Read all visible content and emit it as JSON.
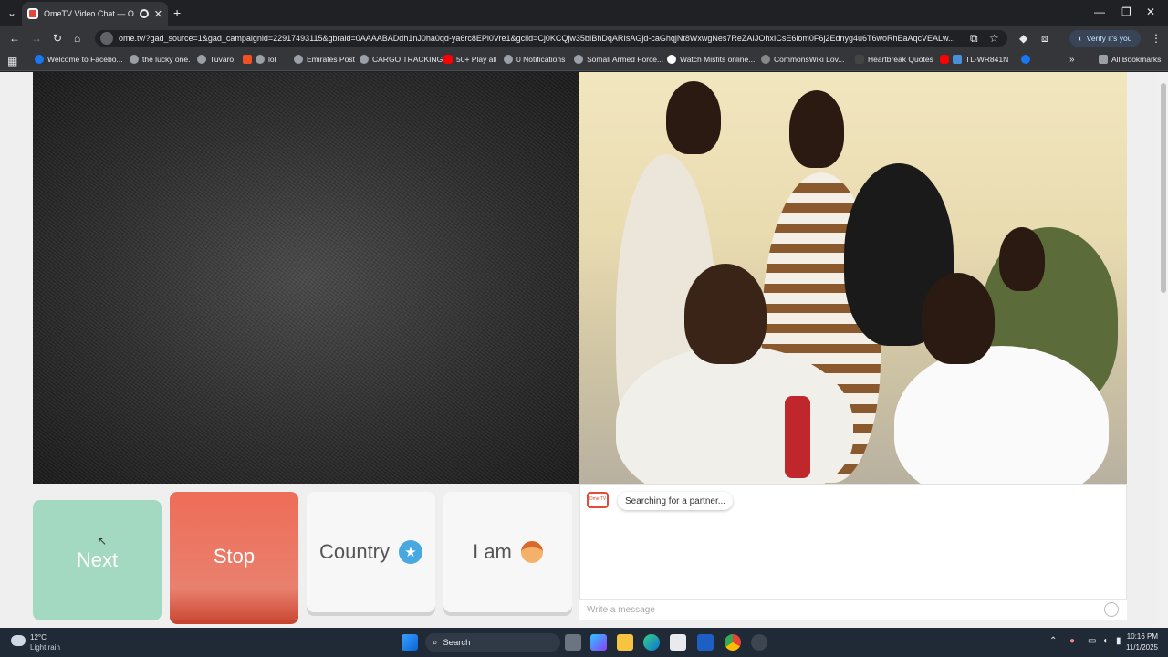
{
  "browser": {
    "tab_title": "OmeTV Video Chat — Omegle",
    "url": "ome.tv/?gad_source=1&gad_campaignid=22917493115&gbraid=0AAAABADdh1nJ0ha0qd-ya6rc8EPi0Vre1&gclid=Cj0KCQjw35bIBhDqARIsAGjd-caGhqjNt8WxwgNes7ReZAIJOhxICsE6lom0F6j2Ednyg4u6T6woRhEaAqcVEALw...",
    "verify_label": "Verify it's you",
    "all_bookmarks": "All Bookmarks",
    "bookmarks": [
      "Welcome to Facebo...",
      "the lucky one.",
      "Tuvaro",
      "lol",
      "Emirates Post",
      "CARGO TRACKING",
      "50+ Play all",
      "0 Notifications",
      "Somali Armed Force...",
      "Watch Misfits online...",
      "CommonsWiki Lov...",
      "Heartbreak Quotes",
      "TL-WR841N"
    ]
  },
  "controls": {
    "next": "Next",
    "stop": "Stop",
    "country": "Country",
    "i_am": "I am"
  },
  "chat": {
    "logo_text": "Ome TV",
    "status_message": "Searching for a partner...",
    "input_placeholder": "Write a message"
  },
  "taskbar": {
    "temperature": "12°C",
    "weather": "Light rain",
    "search_label": "Search",
    "time": "10:16 PM",
    "date": "11/1/2025"
  },
  "colors": {
    "stop": "#ea6b55",
    "next": "#a4d9c1",
    "country_star": "#4aa8e0"
  }
}
